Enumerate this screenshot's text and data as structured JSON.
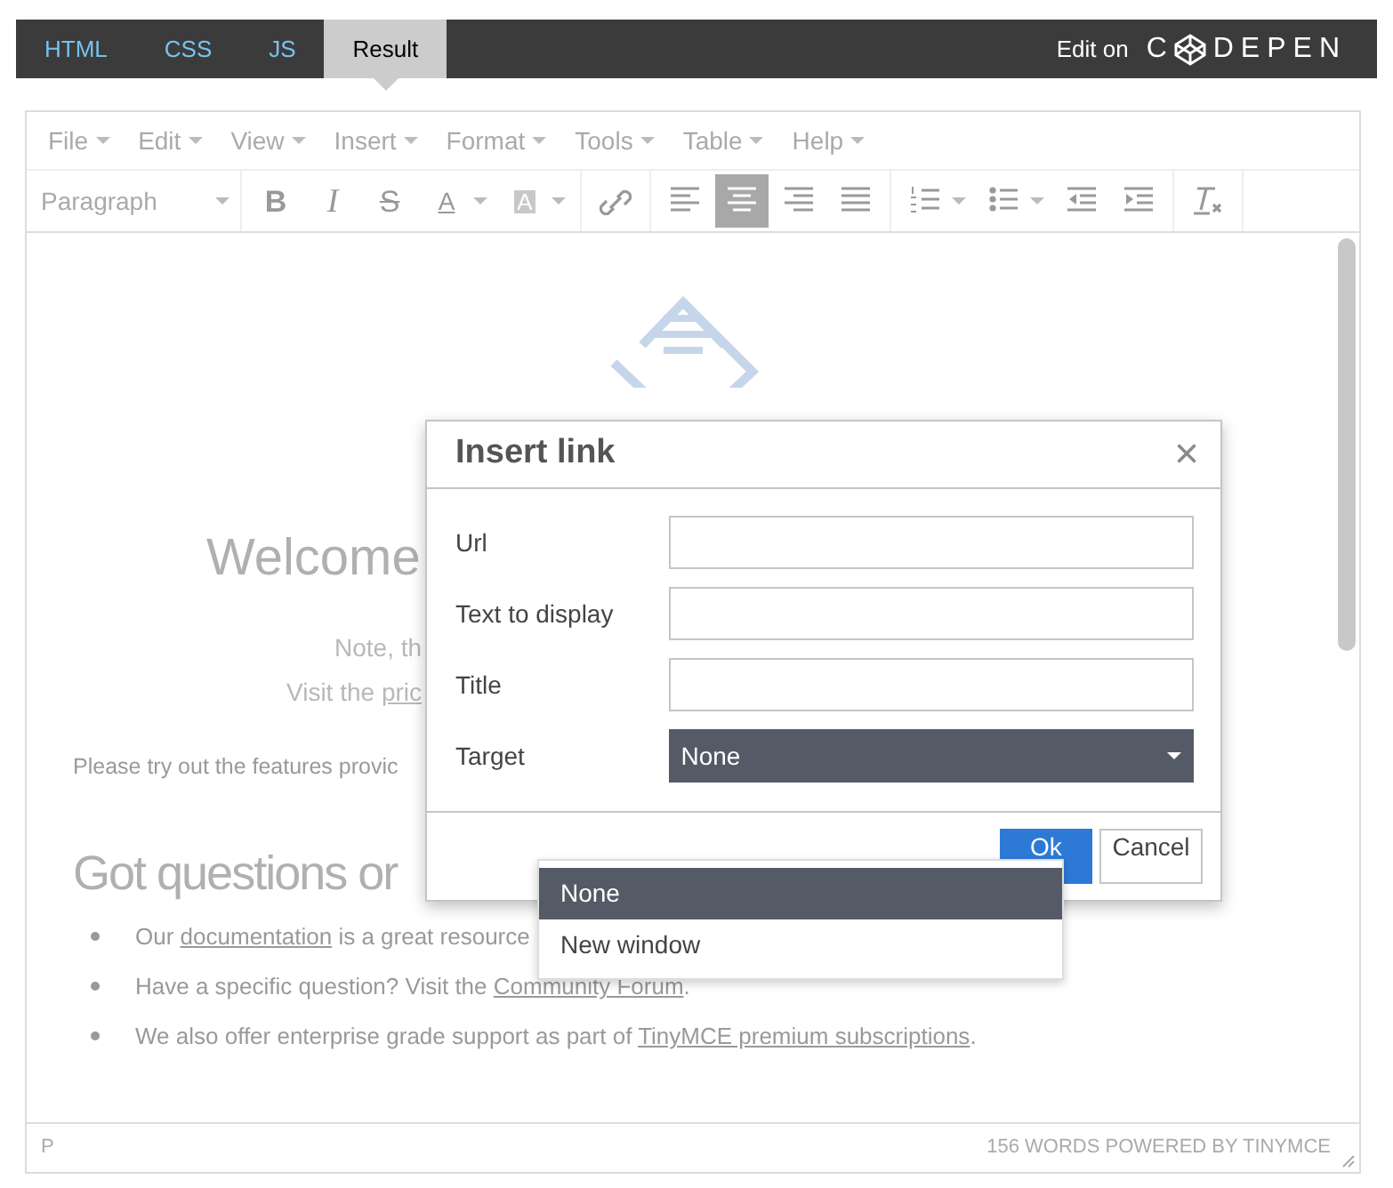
{
  "tabs": [
    {
      "label": "HTML",
      "selected": false
    },
    {
      "label": "CSS",
      "selected": false
    },
    {
      "label": "JS",
      "selected": false
    },
    {
      "label": "Result",
      "selected": true
    }
  ],
  "brand": {
    "edit_label": "Edit on",
    "logo_before": "C",
    "logo_after": "DEPEN"
  },
  "menubar": [
    "File",
    "Edit",
    "View",
    "Insert",
    "Format",
    "Tools",
    "Table",
    "Help"
  ],
  "toolbar": {
    "format_select": "Paragraph",
    "buttons": [
      {
        "glyph": "B",
        "selected": false
      },
      {
        "glyph": "I",
        "selected": false
      },
      {
        "glyph": "S",
        "selected": false
      },
      {
        "glyph": "A",
        "selected": false
      },
      {
        "glyph": "A",
        "selected": false
      },
      {
        "selected": false
      },
      {
        "selected": false
      },
      {
        "selected": true
      },
      {
        "selected": false
      },
      {
        "selected": false
      },
      {
        "selected": false
      },
      {
        "selected": false
      },
      {
        "selected": false
      },
      {
        "selected": false
      },
      {
        "selected": false
      }
    ]
  },
  "content": {
    "heading": "Welcome",
    "note_lines": [
      [
        {
          "text": "Note, th"
        }
      ],
      [
        {
          "text": "Visit the "
        },
        {
          "text": "pric",
          "link": true
        }
      ]
    ],
    "paragraph": "Please try out the features provic",
    "subheading": "Got questions or",
    "bullets": [
      [
        {
          "text": "Our "
        },
        {
          "text": "documentation",
          "link": true
        },
        {
          "text": " is a great resource"
        }
      ],
      [
        {
          "text": "Have a specific question? Visit the "
        },
        {
          "text": "Community Forum",
          "link": true
        },
        {
          "text": "."
        }
      ],
      [
        {
          "text": "We also offer enterprise grade support as part of "
        },
        {
          "text": "TinyMCE premium subscriptions",
          "link": true
        },
        {
          "text": "."
        }
      ]
    ]
  },
  "status_bar": {
    "path": "P",
    "info": "156 WORDS POWERED BY TINYMCE"
  },
  "dialog": {
    "title": "Insert link",
    "close": "×",
    "fields": [
      {
        "label": "Url",
        "kind": "text"
      },
      {
        "label": "Text to display",
        "kind": "text"
      },
      {
        "label": "Title",
        "kind": "text"
      },
      {
        "label": "Target",
        "kind": "select",
        "value": "None"
      }
    ],
    "buttons": [
      {
        "label": "Ok",
        "kind": "primary"
      },
      {
        "label": "Cancel",
        "kind": "default"
      }
    ]
  },
  "dropdown": [
    {
      "label": "None",
      "selected": true
    },
    {
      "label": "New window",
      "selected": false
    }
  ]
}
